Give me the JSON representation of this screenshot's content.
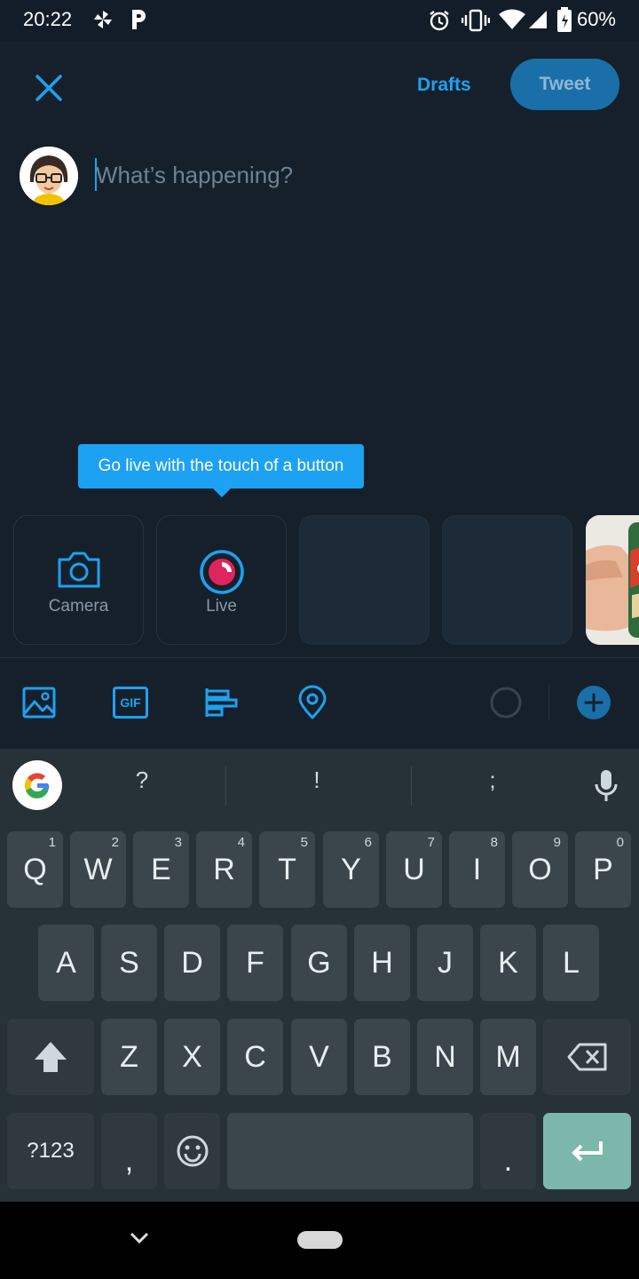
{
  "status_bar": {
    "time": "20:22",
    "battery_percent": "60%",
    "icons": [
      "pinwheel-icon",
      "p-icon",
      "alarm-icon",
      "vibrate-icon",
      "wifi-icon",
      "signal-icon",
      "battery-icon"
    ]
  },
  "header": {
    "close_icon": "close-icon",
    "drafts_label": "Drafts",
    "tweet_label": "Tweet"
  },
  "compose": {
    "placeholder": "What’s happening?",
    "tooltip": "Go live with the touch of a button",
    "tiles": [
      {
        "label": "Camera",
        "icon": "camera-icon"
      },
      {
        "label": "Live",
        "icon": "live-icon"
      }
    ]
  },
  "toolbar": {
    "icons": [
      "image-icon",
      "gif-icon",
      "poll-icon",
      "location-icon",
      "char-counter-icon",
      "add-thread-icon"
    ],
    "gif_label": "GIF"
  },
  "keyboard": {
    "suggestions": [
      "?",
      "!",
      ";"
    ],
    "row1": [
      {
        "key": "Q",
        "hint": "1"
      },
      {
        "key": "W",
        "hint": "2"
      },
      {
        "key": "E",
        "hint": "3"
      },
      {
        "key": "R",
        "hint": "4"
      },
      {
        "key": "T",
        "hint": "5"
      },
      {
        "key": "Y",
        "hint": "6"
      },
      {
        "key": "U",
        "hint": "7"
      },
      {
        "key": "I",
        "hint": "8"
      },
      {
        "key": "O",
        "hint": "9"
      },
      {
        "key": "P",
        "hint": "0"
      }
    ],
    "row2": [
      "A",
      "S",
      "D",
      "F",
      "G",
      "H",
      "J",
      "K",
      "L"
    ],
    "row3": [
      "Z",
      "X",
      "C",
      "V",
      "B",
      "N",
      "M"
    ],
    "symbols_label": "?123",
    "comma": ",",
    "period": ".",
    "colors": {
      "enter": "#7bb8ab",
      "key": "#3b464c",
      "background": "#263238"
    }
  },
  "colors": {
    "accent": "#1da1f2",
    "background": "#15202b",
    "live": "#e0245e"
  }
}
